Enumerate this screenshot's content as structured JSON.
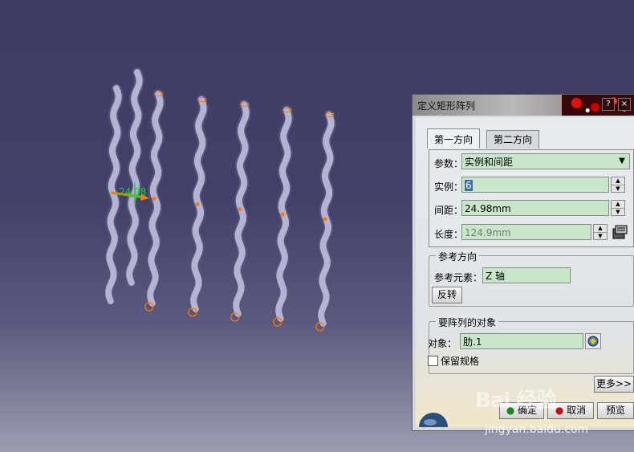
{
  "viewport": {
    "dimension_label": "24.98",
    "background_top": "#3c3c64",
    "background_bottom": "#9c9cb0",
    "spring_color": "#b3b3d4",
    "point_color": "#ff7a00",
    "dimension_color": "#22cc44"
  },
  "dialog": {
    "title": "定义矩形阵列",
    "tabs": [
      {
        "label": "第一方向",
        "active": true
      },
      {
        "label": "第二方向",
        "active": false
      }
    ],
    "params_label": "参数：",
    "params_value": "实例和间距",
    "instance_label": "实例：",
    "instance_value": "6",
    "spacing_label": "间距：",
    "spacing_value": "24.98mm",
    "length_label": "长度：",
    "length_value": "124.9mm",
    "ref_group_title": "参考方向",
    "ref_element_label": "参考元素：",
    "ref_element_value": "Z 轴",
    "reverse_button": "反转",
    "object_group_title": "要阵列的对象",
    "object_label": "对象：",
    "object_value": "肋.1",
    "keep_spec_label": "保留规格",
    "more_button": "更多>>",
    "ok_button": "确定",
    "cancel_button": "取消",
    "preview_button": "预览"
  },
  "watermark": {
    "brand": "Bai 经验",
    "url": "jingyan.baidu.com"
  }
}
